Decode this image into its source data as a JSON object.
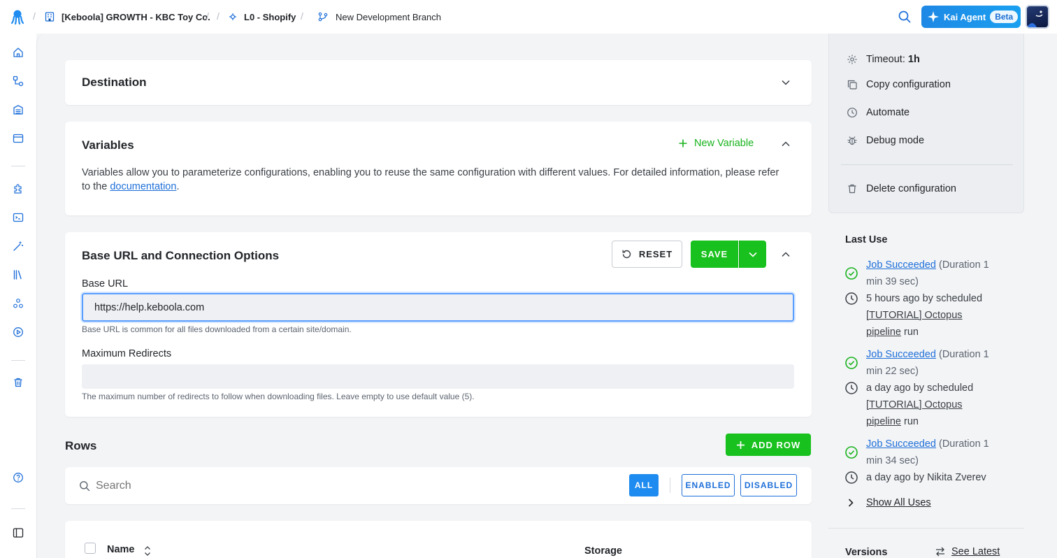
{
  "header": {
    "project": "[Keboola] GROWTH - KBC Toy Co.",
    "config": "L0 - Shopify",
    "branch": "New Development Branch",
    "kai_label": "Kai Agent",
    "kai_badge": "Beta"
  },
  "destination": {
    "title": "Destination"
  },
  "variables": {
    "title": "Variables",
    "new_variable": "New Variable",
    "description_before": "Variables allow you to parameterize configurations, enabling you to reuse the same configuration with different values. For detailed information, please refer to the ",
    "link": "documentation",
    "description_after": "."
  },
  "connection": {
    "title": "Base URL and Connection Options",
    "reset": "RESET",
    "save": "SAVE",
    "base_url_label": "Base URL",
    "base_url_value": "https://help.keboola.com",
    "base_url_help": "Base URL is common for all files downloaded from a certain site/domain.",
    "max_redirects_label": "Maximum Redirects",
    "max_redirects_value": "",
    "max_redirects_help": "The maximum number of redirects to follow when downloading files. Leave empty to use default value (5)."
  },
  "rows": {
    "title": "Rows",
    "add_row": "ADD ROW",
    "search_placeholder": "Search",
    "filters": [
      "ALL",
      "ENABLED",
      "DISABLED"
    ],
    "col_name": "Name",
    "col_storage": "Storage"
  },
  "side_panel": {
    "timeout_label": "Timeout: ",
    "timeout_value": "1h",
    "actions": [
      "Copy configuration",
      "Automate",
      "Debug mode"
    ],
    "delete": "Delete configuration",
    "last_use_title": "Last Use",
    "jobs": [
      {
        "status": "Job Succeeded",
        "duration": " (Duration 1 min 39 sec)",
        "when": "5 hours ago by scheduled ",
        "pipeline": "[TUTORIAL] Octopus pipeline",
        "suffix": " run"
      },
      {
        "status": "Job Succeeded",
        "duration": " (Duration 1 min 22 sec)",
        "when": "a day ago by scheduled ",
        "pipeline": "[TUTORIAL] Octopus pipeline",
        "suffix": " run"
      },
      {
        "status": "Job Succeeded",
        "duration": " (Duration 1 min 34 sec)",
        "when": "a day ago by Nikita Zverev",
        "pipeline": "",
        "suffix": ""
      }
    ],
    "show_all": "Show All Uses",
    "versions_title": "Versions",
    "see_latest": "See Latest"
  },
  "colors": {
    "accent": "#1e6fd9",
    "success": "#18c11d",
    "kai": "#1e88e5"
  }
}
